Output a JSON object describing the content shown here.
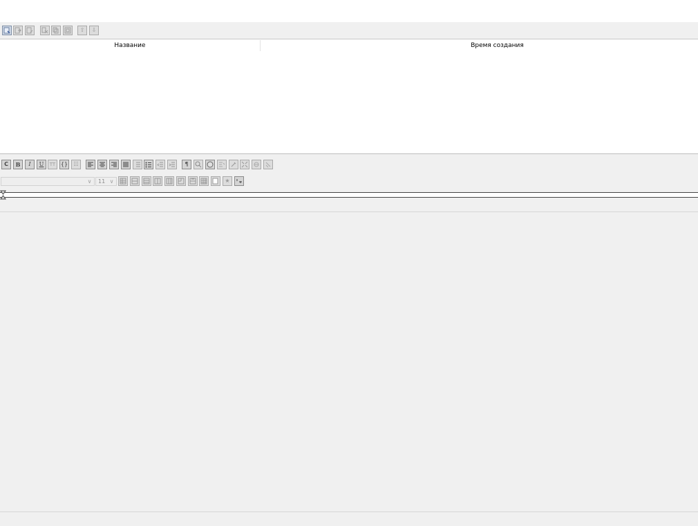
{
  "main_toolbar": {
    "icons": [
      "new-note-icon",
      "export-icon",
      "import-icon",
      "cut-icon",
      "copy-icon",
      "paste-icon",
      "move-up-icon",
      "move-down-icon"
    ]
  },
  "notes_table": {
    "columns": [
      "Название",
      "Время создания"
    ],
    "rows": []
  },
  "format_toolbar": {
    "icons": [
      "clear-format-icon",
      "bold-icon",
      "italic-icon",
      "underline-icon",
      "monospace-icon",
      "code-icon",
      "hr-icon",
      "align-left-icon",
      "align-center-icon",
      "align-right-icon",
      "align-justify-icon",
      "numbered-list-icon",
      "bullet-list-icon",
      "indent-less-icon",
      "indent-more-icon",
      "pilcrow-icon",
      "find-icon",
      "color-icon",
      "image-icon",
      "tool-icon",
      "expand-icon",
      "link-icon",
      "attach-icon"
    ]
  },
  "font_toolbar": {
    "font_family": "",
    "font_size": "11",
    "icons": [
      "table-icon",
      "table-row-add-icon",
      "table-row-del-icon",
      "table-col-add-icon",
      "table-col-del-icon",
      "table-merge-icon",
      "table-split-icon",
      "table-props-icon",
      "table-cell-icon",
      "star-icon",
      "special-char-icon"
    ]
  },
  "colors": {
    "panel": "#f0f0f0",
    "border": "#c8c8c8",
    "button": "#dcdcdc"
  }
}
